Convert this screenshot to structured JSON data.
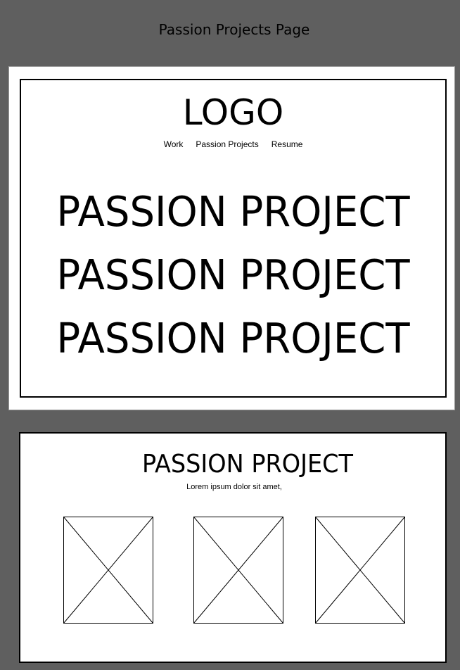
{
  "page_title": "Passion Projects Page",
  "hero": {
    "logo": "LOGO",
    "nav": [
      "Work",
      "Passion Projects",
      "Resume"
    ],
    "lines": [
      "PASSION PROJECT",
      "PASSION PROJECT",
      "PASSION PROJECT"
    ]
  },
  "section": {
    "title": "PASSION PROJECT",
    "subtitle": "Lorem ipsum dolor sit amet,",
    "placeholders": [
      "image-placeholder",
      "image-placeholder",
      "image-placeholder"
    ]
  },
  "colors": {
    "canvas": "#5f5f5f",
    "artboard": "#ffffff",
    "stroke": "#000000"
  }
}
